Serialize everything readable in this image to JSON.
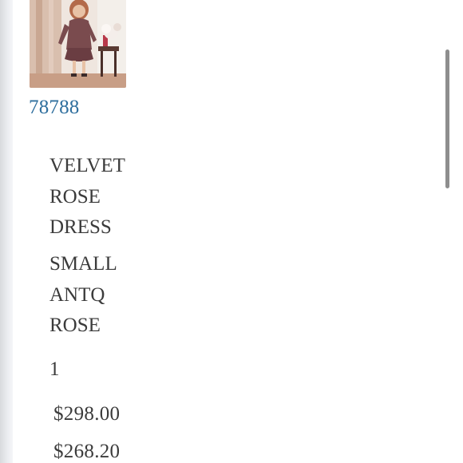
{
  "order_item": {
    "sku": "78788",
    "product_name": "VELVET ROSE DRESS",
    "variant": "SMALL ANTQ ROSE",
    "quantity": "1",
    "price": "$298.00",
    "sale_price": "$268.20"
  },
  "thumbnail": {
    "icon": "product-photo-dress",
    "colors": {
      "dress": "#7a4b4e",
      "curtain": "#cfae9c",
      "skin": "#e8c2a6",
      "hair": "#b36a4a"
    }
  },
  "link_color": "#2f6f9e",
  "text_color": "#3b3b3b"
}
